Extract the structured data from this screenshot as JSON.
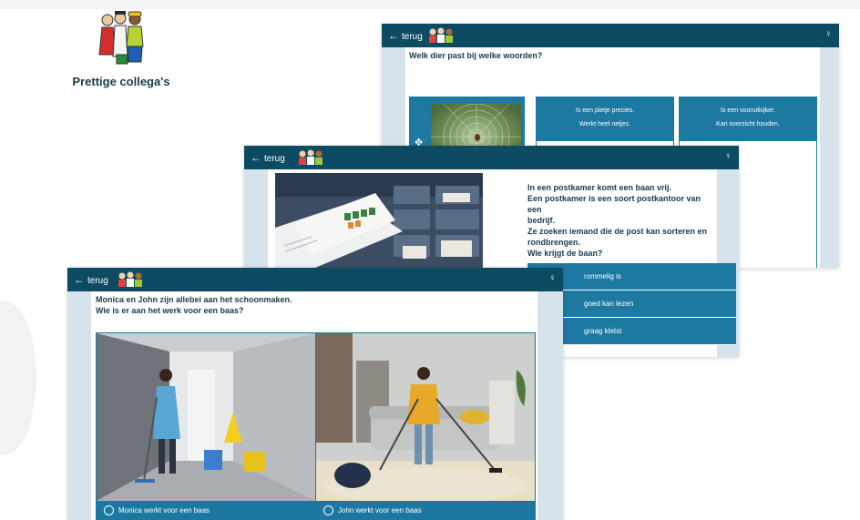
{
  "header": {
    "title": "Prettige collega's"
  },
  "app": {
    "back_label": "terug",
    "colors": {
      "topbar": "#0d4b62",
      "accent": "#1d79a2",
      "panel": "#d6e3ea"
    },
    "icons": {
      "back": "arrow-left-icon",
      "hint": "lightbulb-icon",
      "move": "move-icon"
    }
  },
  "screen_back": {
    "question": "Welk dier past bij welke woorden?",
    "options": [
      {
        "lines": [
          "Is een pietje precies.",
          "Werkt heel netjes."
        ]
      },
      {
        "lines": [
          "Is een vooruitkijker.",
          "Kan overzicht houden."
        ]
      }
    ]
  },
  "screen_middle": {
    "question_lines": [
      "In een postkamer komt een baan vrij.",
      "Een postkamer is een soort postkantoor van een",
      "bedrijf.",
      "Ze zoeken iemand die de post kan sorteren en",
      "rondbrengen.",
      "Wie krijgt de baan?"
    ],
    "answers": [
      {
        "label": "rommelig is"
      },
      {
        "label": "goed kan lezen"
      },
      {
        "label": "graag kletst"
      }
    ]
  },
  "screen_front": {
    "question_lines": [
      "Monica en John zijn allebei aan het schoonmaken.",
      "Wie is er aan het werk voor een baas?"
    ],
    "choices": [
      {
        "label": "Monica werkt voor een baas"
      },
      {
        "label": "John werkt voor een baas"
      }
    ]
  }
}
